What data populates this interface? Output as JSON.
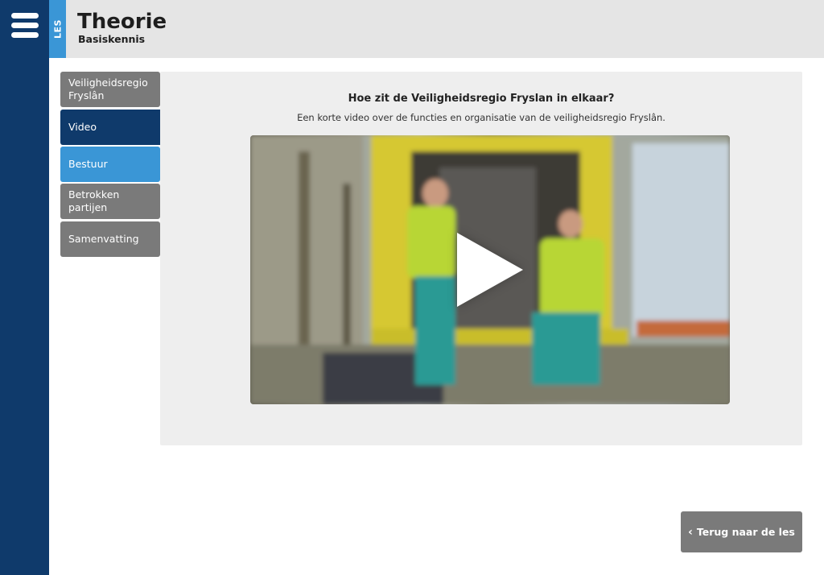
{
  "header": {
    "section_tab": "LES",
    "title": "Theorie",
    "subtitle": "Basiskennis"
  },
  "nav": {
    "items": [
      {
        "label": "Veiligheidsregio Fryslân",
        "state": "default"
      },
      {
        "label": "Video",
        "state": "active"
      },
      {
        "label": "Bestuur",
        "state": "highlight"
      },
      {
        "label": "Betrokken partijen",
        "state": "default"
      },
      {
        "label": "Samenvatting",
        "state": "default"
      }
    ]
  },
  "content": {
    "title": "Hoe zit de Veiligheidsregio Fryslan in elkaar?",
    "description": "Een korte video over de functies en organisatie van de veiligheidsregio Fryslân."
  },
  "footer": {
    "back_label": "Terug naar de les"
  },
  "icons": {
    "menu": "hamburger-menu-icon",
    "nav_active": "play-icon",
    "video": "play-icon",
    "back": "chevron-left-icon"
  },
  "colors": {
    "sidebar": "#0f3a6b",
    "accent": "#3a96d6",
    "nav_gray": "#7a7a7a",
    "header_bg": "#e5e5e5",
    "content_bg": "#eeeeee"
  }
}
